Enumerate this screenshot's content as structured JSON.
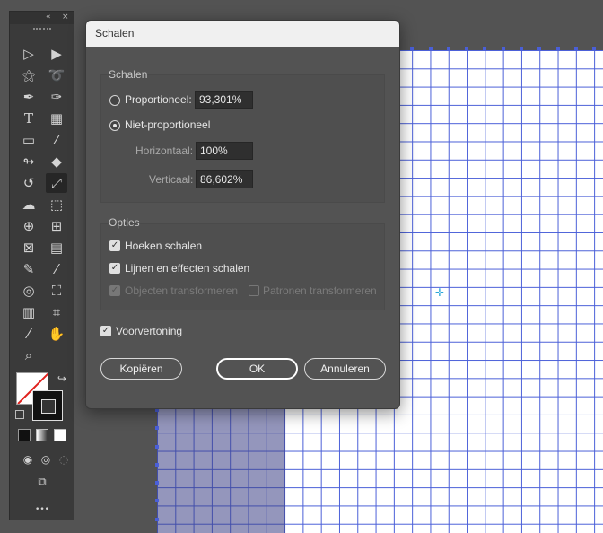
{
  "dialog": {
    "title": "Schalen",
    "scale_group": {
      "title": "Schalen",
      "uniform_label": "Proportioneel:",
      "uniform_value": "93,301%",
      "non_uniform_label": "Niet-proportioneel",
      "horizontal_label": "Horizontaal:",
      "horizontal_value": "100%",
      "vertical_label": "Verticaal:",
      "vertical_value": "86,602%"
    },
    "options_group": {
      "title": "Opties",
      "scale_corners": "Hoeken schalen",
      "scale_strokes": "Lijnen en effecten schalen",
      "transform_objects": "Objecten transformeren",
      "transform_patterns": "Patronen transformeren"
    },
    "preview_label": "Voorvertoning",
    "buttons": {
      "copy": "Kopiëren",
      "ok": "OK",
      "cancel": "Annuleren"
    }
  },
  "toolbar": {
    "collapse": "«",
    "close": "×",
    "more": "•••"
  },
  "colors": {
    "canvas_bg": "#535353",
    "grid_line": "#4a5fd8",
    "dialog_bg": "#535353",
    "titlebar_bg": "#f0f0f0",
    "fill_none_slash": "#e0211d"
  }
}
